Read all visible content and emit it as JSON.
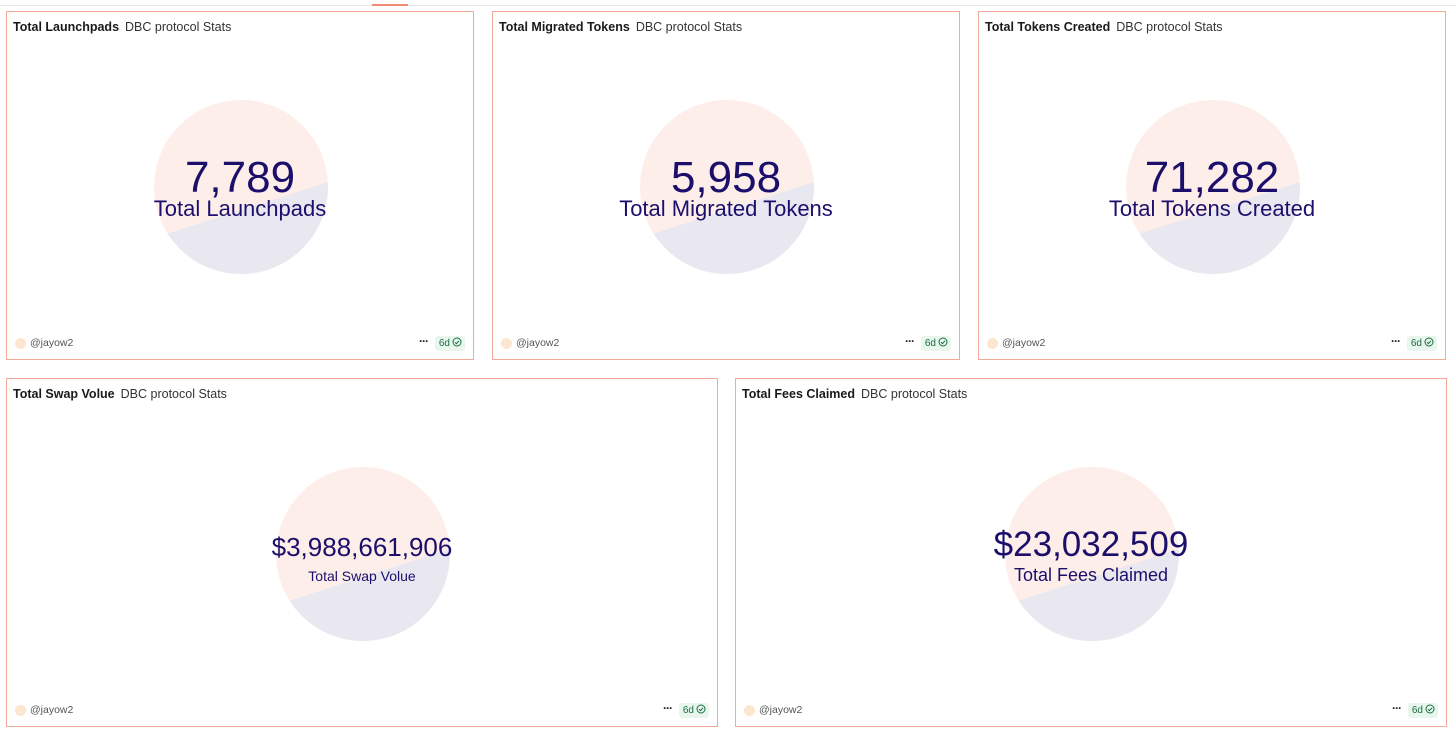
{
  "colors": {
    "card_border": "#f3a99a",
    "value_text": "#1b0f6b",
    "circle_peach": "#fdeeea",
    "circle_lavender": "#e9e8f1",
    "badge_bg": "#e8f6ee",
    "badge_text": "#1a6e3e"
  },
  "cards": [
    {
      "title": "Total Launchpads",
      "subtitle": "DBC protocol Stats",
      "value": "7,789",
      "label": "Total Launchpads",
      "author": "@jayow2",
      "age": "6d",
      "icons": [
        "avatar-icon",
        "more-icon",
        "check-circle-icon"
      ]
    },
    {
      "title": "Total Migrated Tokens",
      "subtitle": "DBC protocol Stats",
      "value": "5,958",
      "label": "Total Migrated Tokens",
      "author": "@jayow2",
      "age": "6d",
      "icons": [
        "avatar-icon",
        "more-icon",
        "check-circle-icon"
      ]
    },
    {
      "title": "Total Tokens Created",
      "subtitle": "DBC protocol Stats",
      "value": "71,282",
      "label": "Total Tokens Created",
      "author": "@jayow2",
      "age": "6d",
      "icons": [
        "avatar-icon",
        "more-icon",
        "check-circle-icon"
      ]
    },
    {
      "title": "Total Swap Volue",
      "subtitle": "DBC protocol Stats",
      "value": "$3,988,661,906",
      "label": "Total Swap Volue",
      "author": "@jayow2",
      "age": "6d",
      "icons": [
        "avatar-icon",
        "more-icon",
        "check-circle-icon"
      ]
    },
    {
      "title": "Total Fees Claimed",
      "subtitle": "DBC protocol Stats",
      "value": "$23,032,509",
      "label": "Total Fees Claimed",
      "author": "@jayow2",
      "age": "6d",
      "icons": [
        "avatar-icon",
        "more-icon",
        "check-circle-icon"
      ]
    }
  ]
}
